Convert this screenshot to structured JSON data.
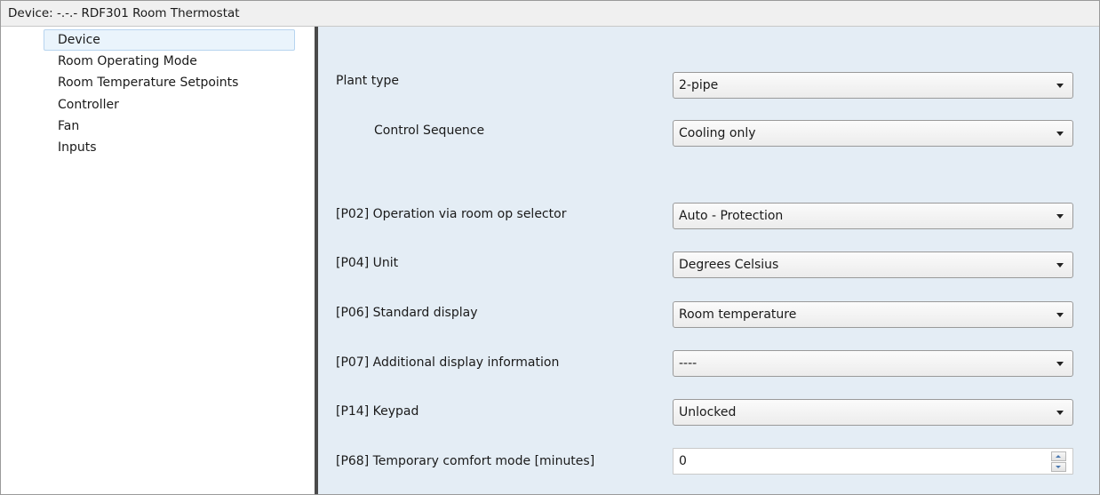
{
  "window": {
    "title": "Device: -.-.-  RDF301 Room Thermostat"
  },
  "sidebar": {
    "items": [
      {
        "label": "Device",
        "selected": true
      },
      {
        "label": "Room Operating Mode"
      },
      {
        "label": "Room Temperature Setpoints"
      },
      {
        "label": "Controller"
      },
      {
        "label": "Fan"
      },
      {
        "label": "Inputs"
      }
    ]
  },
  "params": {
    "plant_type": {
      "label": "Plant type",
      "value": "2-pipe"
    },
    "control_sequence": {
      "label": "Control Sequence",
      "value": "Cooling only"
    },
    "p02": {
      "label": "[P02] Operation via room op selector",
      "value": "Auto - Protection"
    },
    "p04": {
      "label": "[P04] Unit",
      "value": "Degrees Celsius"
    },
    "p06": {
      "label": "[P06] Standard display",
      "value": "Room temperature"
    },
    "p07": {
      "label": "[P07] Additional display information",
      "value": "----"
    },
    "p14": {
      "label": "[P14] Keypad",
      "value": "Unlocked"
    },
    "p68": {
      "label": "[P68] Temporary comfort mode [minutes]",
      "value": "0"
    }
  },
  "icons": {
    "dropdown": "chevron-down-icon",
    "spin_up": "arrow-up-icon",
    "spin_down": "arrow-down-icon"
  },
  "colors": {
    "content_bg": "#e4edf5",
    "selection_bg": "#eaf4fc",
    "splitter": "#4a4a4a"
  }
}
